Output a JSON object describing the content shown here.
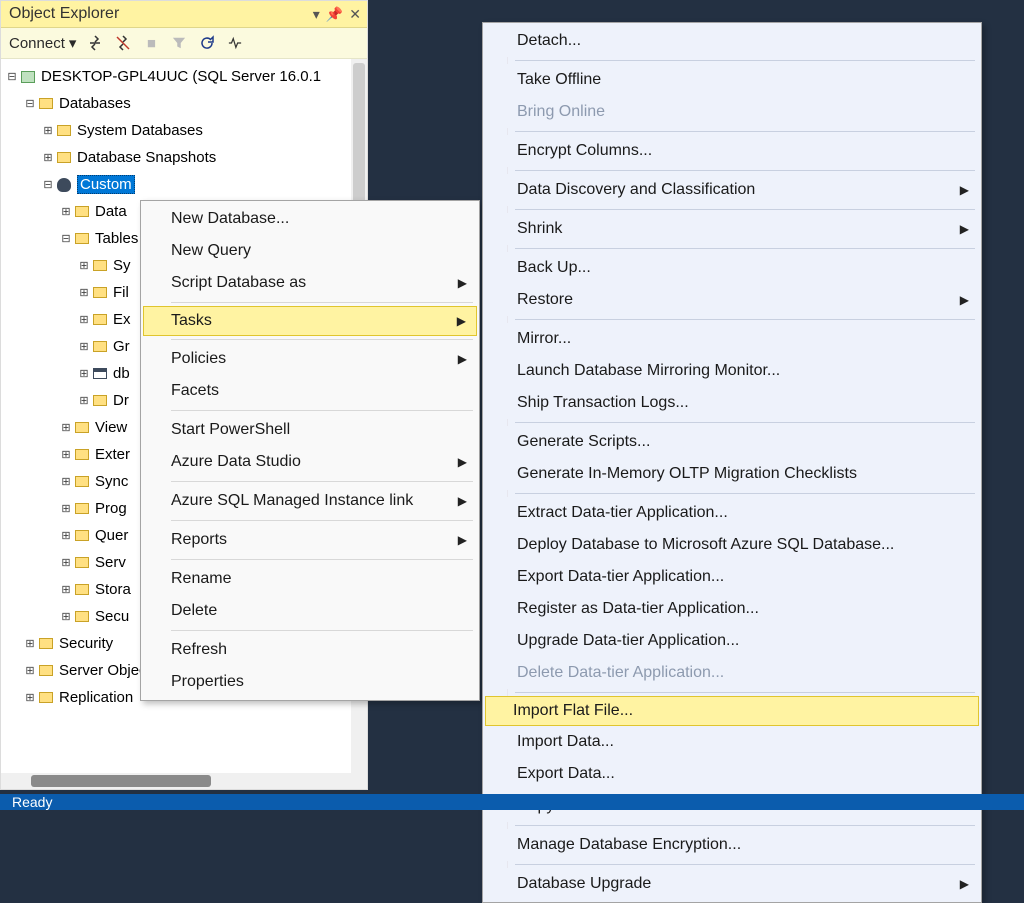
{
  "panel": {
    "title": "Object Explorer",
    "connect_label": "Connect"
  },
  "tree": {
    "server": "DESKTOP-GPL4UUC (SQL Server 16.0.1",
    "databases": "Databases",
    "sysdb": "System Databases",
    "snapshots": "Database Snapshots",
    "custom": "Custom",
    "data": "Data",
    "tables": "Tables",
    "sy": "Sy",
    "fil": "Fil",
    "ex": "Ex",
    "gr": "Gr",
    "db": "db",
    "dr": "Dr",
    "views": "View",
    "exter": "Exter",
    "sync": "Sync",
    "prog": "Prog",
    "quer": "Quer",
    "serv": "Serv",
    "stora": "Stora",
    "secu": "Secu",
    "security": "Security",
    "server_objects": "Server Objects",
    "replication": "Replication"
  },
  "menu1": {
    "new_db": "New Database...",
    "new_query": "New Query",
    "script_as": "Script Database as",
    "tasks": "Tasks",
    "policies": "Policies",
    "facets": "Facets",
    "start_ps": "Start PowerShell",
    "ads": "Azure Data Studio",
    "ami": "Azure SQL Managed Instance link",
    "reports": "Reports",
    "rename": "Rename",
    "delete": "Delete",
    "refresh": "Refresh",
    "properties": "Properties"
  },
  "menu2": {
    "detach": "Detach...",
    "take_offline": "Take Offline",
    "bring_online": "Bring Online",
    "encrypt_cols": "Encrypt Columns...",
    "ddc": "Data Discovery and Classification",
    "shrink": "Shrink",
    "backup": "Back Up...",
    "restore": "Restore",
    "mirror": "Mirror...",
    "launch_mirror_mon": "Launch Database Mirroring Monitor...",
    "ship_logs": "Ship Transaction Logs...",
    "gen_scripts": "Generate Scripts...",
    "gen_oltp": "Generate In-Memory OLTP Migration Checklists",
    "extract_dta": "Extract Data-tier Application...",
    "deploy_azure": "Deploy Database to Microsoft Azure SQL Database...",
    "export_dta": "Export Data-tier Application...",
    "register_dta": "Register as Data-tier Application...",
    "upgrade_dta": "Upgrade Data-tier Application...",
    "delete_dta": "Delete Data-tier Application...",
    "import_flat": "Import Flat File...",
    "import_data": "Import Data...",
    "export_data": "Export Data...",
    "copy_db": "Copy Database...",
    "manage_enc": "Manage Database Encryption...",
    "db_upgrade": "Database Upgrade"
  },
  "status": {
    "text": "Ready"
  }
}
